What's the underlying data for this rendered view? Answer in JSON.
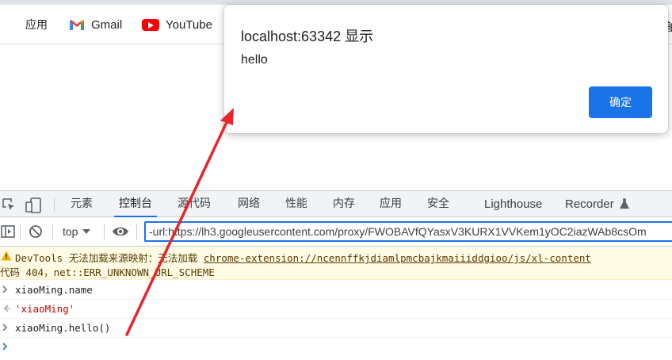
{
  "bookmarks": [
    {
      "label": "应用",
      "icon": "apps-grid-icon"
    },
    {
      "label": "Gmail",
      "icon": "gmail-icon"
    },
    {
      "label": "YouTube",
      "icon": "youtube-icon"
    }
  ],
  "bookmarks_overflow": "舶",
  "dialog": {
    "title": "localhost:63342 显示",
    "message": "hello",
    "ok_label": "确定",
    "accent": "#1a73e8"
  },
  "devtools": {
    "tabs": [
      {
        "label": "元素",
        "active": false
      },
      {
        "label": "控制台",
        "active": true
      },
      {
        "label": "源代码",
        "active": false
      },
      {
        "label": "网络",
        "active": false
      },
      {
        "label": "性能",
        "active": false
      },
      {
        "label": "内存",
        "active": false
      },
      {
        "label": "应用",
        "active": false
      },
      {
        "label": "安全",
        "active": false
      },
      {
        "label": "Lighthouse",
        "active": false
      },
      {
        "label": "Recorder",
        "active": false
      }
    ],
    "context": "top",
    "filter": "-url:https://lh3.googleusercontent.com/proxy/FWOBAVfQYasxV3KURX1VVKem1yOC2iazWAb8csOm"
  },
  "console": {
    "warning": {
      "text": "DevTools 无法加载来源映射：无法加载",
      "link": "chrome-extension://ncennffkjdiamlpmcbajkmaiiiddgioo/js/xl-content",
      "line2": "代码 404，net::ERR_UNKNOWN_URL_SCHEME",
      "color": "#fffbe5"
    },
    "entries": [
      {
        "type": "input",
        "text": "xiaoMing.name"
      },
      {
        "type": "output",
        "text": "'xiaoMing'"
      },
      {
        "type": "input",
        "text": "xiaoMing.hello()"
      }
    ]
  },
  "annotation_color": "#e8262b"
}
